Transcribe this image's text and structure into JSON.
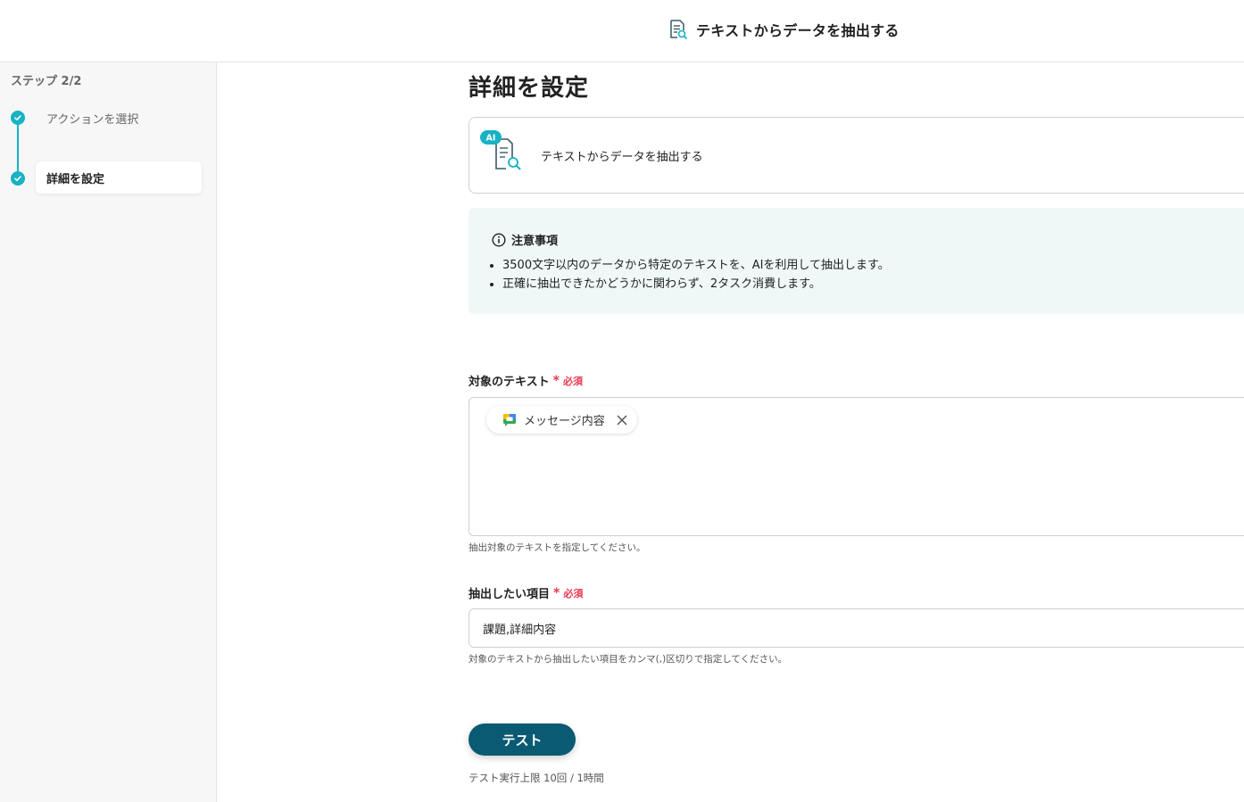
{
  "header": {
    "title": "テキストからデータを抽出する"
  },
  "sidebar": {
    "step_count": "ステップ 2/2",
    "steps": [
      {
        "label": "アクションを選択"
      },
      {
        "label": "詳細を設定"
      }
    ]
  },
  "main": {
    "page_title": "詳細を設定",
    "action_card": {
      "badge": "AI",
      "label": "テキストからデータを抽出する"
    },
    "notice": {
      "title": "注意事項",
      "items": [
        "3500文字以内のデータから特定のテキストを、AIを利用して抽出します。",
        "正確に抽出できたかどうかに関わらず、2タスク消費します。"
      ]
    },
    "target_text": {
      "label": "対象のテキスト",
      "required_mark": "*",
      "required_text": "必須",
      "chip_label": "メッセージ内容",
      "help": "抽出対象のテキストを指定してください。"
    },
    "extract_items": {
      "label": "抽出したい項目",
      "required_mark": "*",
      "required_text": "必須",
      "value": "課題,詳細内容",
      "help": "対象のテキストから抽出したい項目をカンマ(,)区切りで指定してください。"
    },
    "test_button": "テスト",
    "test_limit": "テスト実行上限 10回 / 1時間"
  },
  "colors": {
    "accent": "#17b2c4",
    "button": "#0a5a73",
    "required": "#e8384f",
    "notice_bg": "#eff8f7"
  }
}
